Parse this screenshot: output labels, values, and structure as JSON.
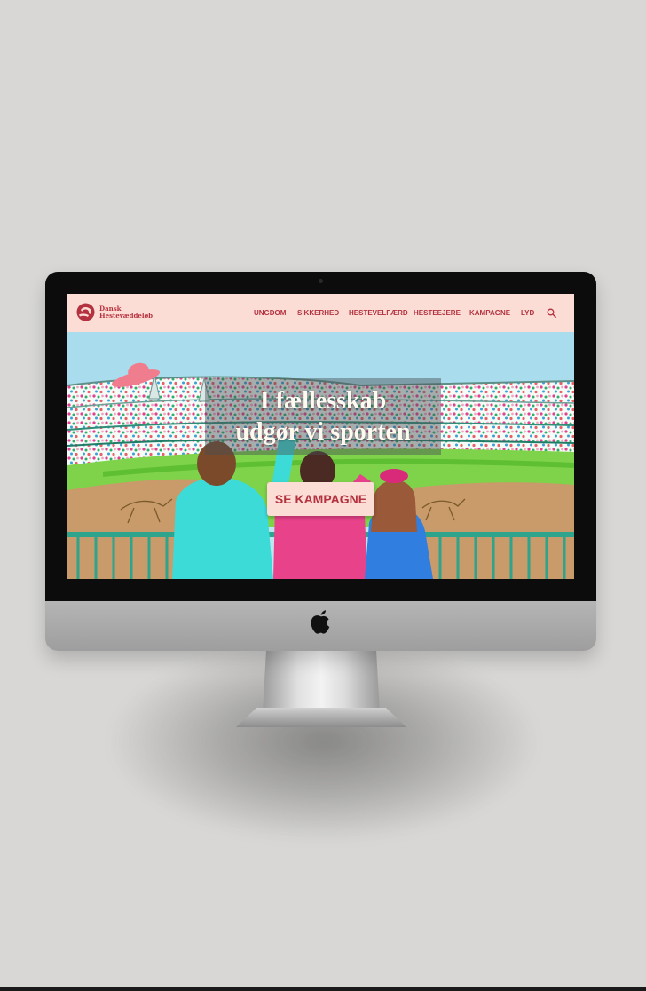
{
  "site": {
    "logo_text_line1": "Dansk",
    "logo_text_line2": "Hestevæddeløb",
    "nav": [
      "UNGDOM",
      "SIKKERHED",
      "HESTEVELFÆRD",
      "HESTEEJERE",
      "KAMPAGNE",
      "LYD"
    ],
    "search_icon": "search-icon"
  },
  "hero": {
    "headline_line1": "I fællesskab",
    "headline_line2": "udgør vi sporten",
    "cta_label": "SE KAMPAGNE"
  },
  "colors": {
    "brand": "#b4313f",
    "nav_background": "#fbddd5",
    "page_background": "#d8d7d5"
  },
  "device": {
    "logo_icon": "apple-logo-icon"
  }
}
